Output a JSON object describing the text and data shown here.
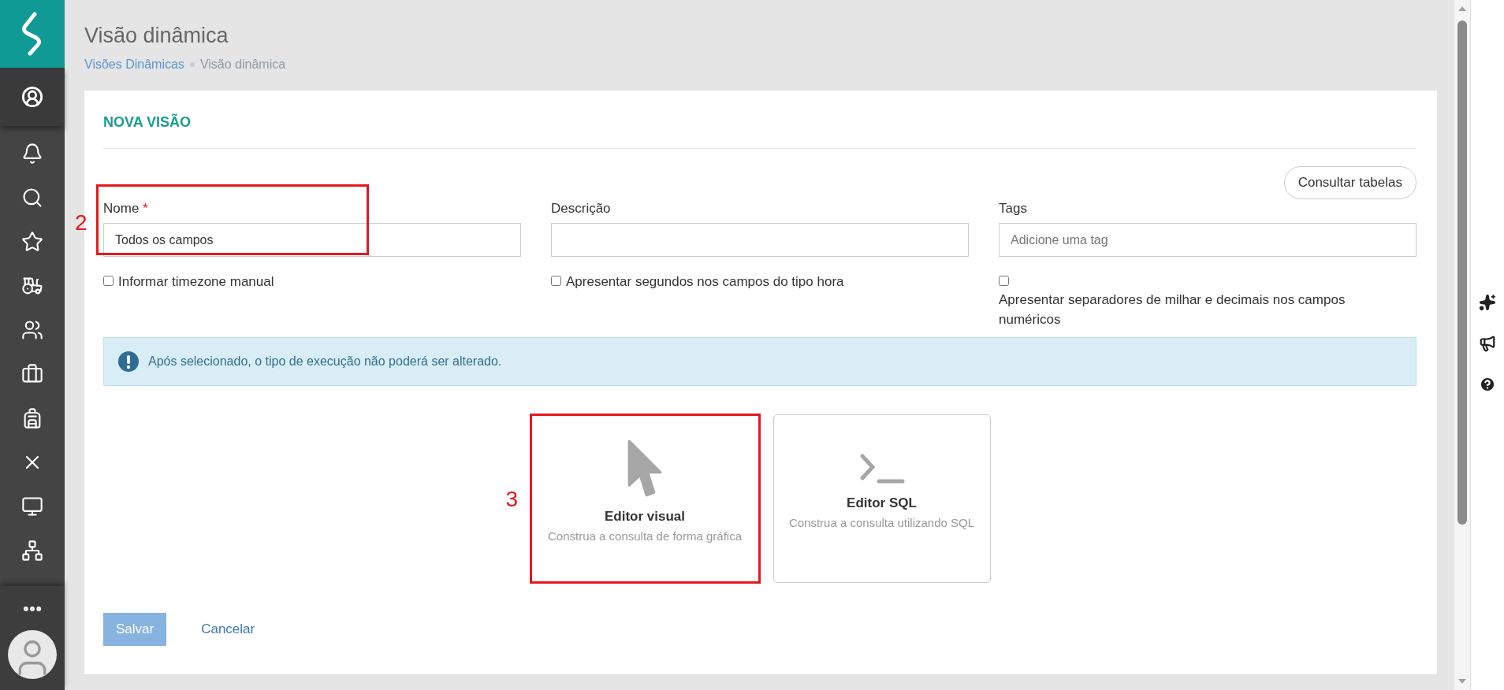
{
  "page": {
    "title": "Visão dinâmica",
    "breadcrumb": [
      {
        "label": "Visões Dinâmicas",
        "kind": "link"
      },
      {
        "label": "Visão dinâmica",
        "kind": "current"
      }
    ]
  },
  "form": {
    "title": "NOVA VISÃO",
    "action_button": "Consultar tabelas",
    "fields": [
      {
        "label": "Nome",
        "required_mark": "*",
        "value": "Todos os campos",
        "annotation": "2"
      },
      {
        "label": "Descrição"
      },
      {
        "label": "Tags",
        "placeholder": "Adicione uma tag"
      }
    ],
    "options": [
      {
        "label": "Informar timezone manual",
        "checked": false,
        "kind": "inline"
      },
      {
        "label": "Apresentar segundos nos campos do tipo hora",
        "checked": false,
        "kind": "inline"
      },
      {
        "label": "Apresentar separadores de milhar e decimais nos campos numéricos",
        "checked": false,
        "kind": "stacked"
      }
    ],
    "alert": "Após selecionado, o tipo de execução não poderá ser alterado.",
    "editors": [
      {
        "kind": "visual",
        "title": "Editor visual",
        "subtitle": "Construa a consulta de forma gráfica",
        "annotation": "3"
      },
      {
        "kind": "sql",
        "title": "Editor SQL",
        "subtitle": "Construa a consulta utilizando SQL"
      }
    ],
    "buttons": [
      {
        "label": "Salvar",
        "kind": "primary",
        "disabled": true
      },
      {
        "label": "Cancelar",
        "kind": "link",
        "disabled": false
      }
    ]
  }
}
